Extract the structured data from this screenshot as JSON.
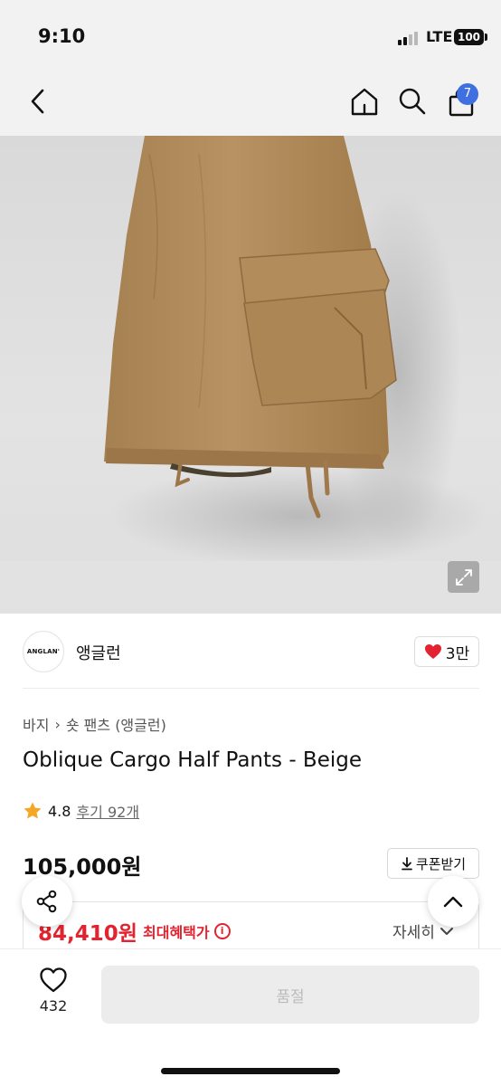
{
  "status_bar": {
    "time": "9:10",
    "network": "LTE",
    "battery": "100"
  },
  "nav": {
    "cart_count": "7"
  },
  "brand": {
    "logo_text": "ANGLAN'",
    "name": "앵글런",
    "like_count": "3만"
  },
  "breadcrumb": [
    "바지",
    "숏 팬츠 (앵글런)"
  ],
  "product": {
    "title": "Oblique Cargo Half Pants - Beige",
    "rating": "4.8",
    "review_label": "후기 92개",
    "price": "105,000원",
    "sale_price": "84,410원",
    "benefit_label": "최대혜택가",
    "detail_label": "자세히"
  },
  "coupon": {
    "label": "쿠폰받기"
  },
  "bottom": {
    "wish_count": "432",
    "soldout_label": "품절"
  },
  "colors": {
    "accent_red": "#e3232f",
    "badge_blue": "#3f6fe0",
    "pants_beige": "#b0895a",
    "star": "#f5a623"
  }
}
